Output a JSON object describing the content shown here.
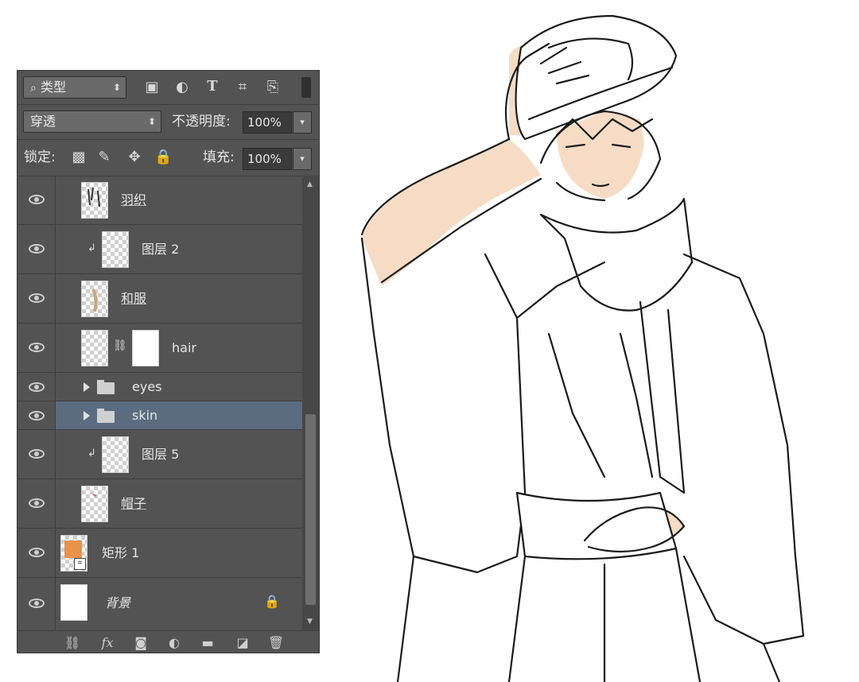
{
  "layers_panel": {
    "filter_kind": "类型",
    "blend_mode": "穿透",
    "opacity_label": "不透明度:",
    "opacity_value": "100%",
    "lock_label": "锁定:",
    "fill_label": "填充:",
    "fill_value": "100%",
    "layers": [
      {
        "name": "羽织",
        "type": "layer",
        "visible": true
      },
      {
        "name": "图层 2",
        "type": "clipped-layer",
        "visible": true
      },
      {
        "name": "和服",
        "type": "layer",
        "visible": true
      },
      {
        "name": "hair",
        "type": "masked-layer",
        "visible": true
      },
      {
        "name": "eyes",
        "type": "group",
        "visible": true
      },
      {
        "name": "skin",
        "type": "group",
        "visible": true,
        "selected": true
      },
      {
        "name": "图层 5",
        "type": "clipped-layer",
        "visible": true
      },
      {
        "name": "帽子",
        "type": "layer",
        "visible": true
      },
      {
        "name": "矩形 1",
        "type": "shape-layer",
        "visible": true
      },
      {
        "name": "背景",
        "type": "background",
        "visible": true,
        "locked": true
      }
    ],
    "bottom_icons": [
      "link-icon",
      "fx-icon",
      "mask-icon",
      "adjustment-icon",
      "folder-icon",
      "new-layer-icon",
      "trash-icon"
    ]
  },
  "colors": {
    "panel_bg": "#535353",
    "selected_row": "#5b6c80",
    "skin_fill": "#f6dcc4",
    "swatch_orange": "#e8924a"
  }
}
